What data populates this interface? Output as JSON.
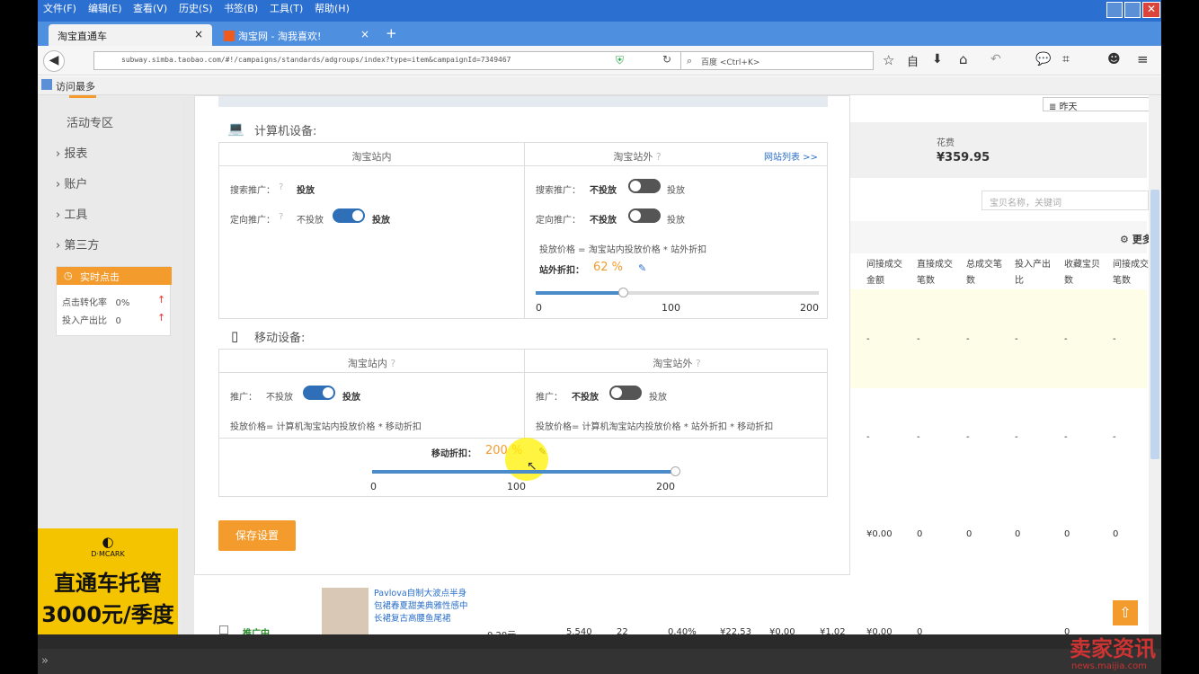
{
  "menu": [
    "文件(F)",
    "编辑(E)",
    "查看(V)",
    "历史(S)",
    "书签(B)",
    "工具(T)",
    "帮助(H)"
  ],
  "tabs": [
    {
      "label": "淘宝直通车"
    },
    {
      "label": "淘宝网 - 淘我喜欢!"
    }
  ],
  "url": "subway.simba.taobao.com/#!/campaigns/standards/adgroups/index?type=item&campaignId=7349467",
  "search_placeholder": "百度 <Ctrl+K>",
  "bookmark": "访问最多",
  "sidebar": {
    "items": [
      "活动专区",
      "报表",
      "账户",
      "工具",
      "第三方"
    ]
  },
  "realtime": {
    "title": "实时点击",
    "rows": [
      {
        "label": "点击转化率",
        "value": "0%"
      },
      {
        "label": "投入产出比",
        "value": "0"
      }
    ]
  },
  "ad": {
    "brand": "D·MCARK",
    "line1": "直通车托管",
    "line2": "3000元/季度"
  },
  "dialog": {
    "pc_title": "计算机设备:",
    "mobile_title": "移动设备:",
    "inside": "淘宝站内",
    "outside": "淘宝站外",
    "site_list": "网站列表 >>",
    "search_promo": "搜索推广：",
    "target_promo": "定向推广：",
    "promo": "推广：",
    "deliver": "投放",
    "no_deliver": "不投放",
    "pc_outside_price": "投放价格 = 淘宝站内投放价格 * 站外折扣",
    "outside_discount_label": "站外折扣：",
    "outside_discount_value": "62 %",
    "outside_discount": 62,
    "mobile_inside_price": "投放价格= 计算机淘宝站内投放价格 * 移动折扣",
    "mobile_outside_price": "投放价格= 计算机淘宝站内投放价格 * 站外折扣 * 移动折扣",
    "mobile_discount_label": "移动折扣：",
    "mobile_discount_value": "200 %",
    "mobile_discount": 200,
    "ticks": [
      "0",
      "100",
      "200"
    ],
    "save": "保存设置"
  },
  "right": {
    "range": "昨天",
    "cost_label": "花费",
    "cost_value": "¥359.95",
    "search_placeholder": "宝贝名称，关键词",
    "more": "更多",
    "headers": [
      "间接成交金额",
      "直接成交笔数",
      "总成交笔数",
      "投入产出比",
      "收藏宝贝数",
      "间接成交笔数"
    ],
    "dash": "-",
    "row3": [
      "¥0.00",
      "0",
      "0",
      "0",
      "0",
      "0"
    ],
    "product": {
      "status": "推广中",
      "title": "Pavlova自制大波点半身包裙春夏甜美典雅性感中长裙复古高腰鱼尾裙",
      "price": "0.20元",
      "score": "5.540",
      "n1": "22",
      "pct": "0.40%",
      "v1": "¥22.53",
      "v2": "¥0.00",
      "v3": "¥1.02",
      "v4": "¥0.00",
      "v5": "0",
      "v6": "0"
    }
  },
  "watermark": "卖家资讯",
  "watermark_url": "news.maijia.com"
}
